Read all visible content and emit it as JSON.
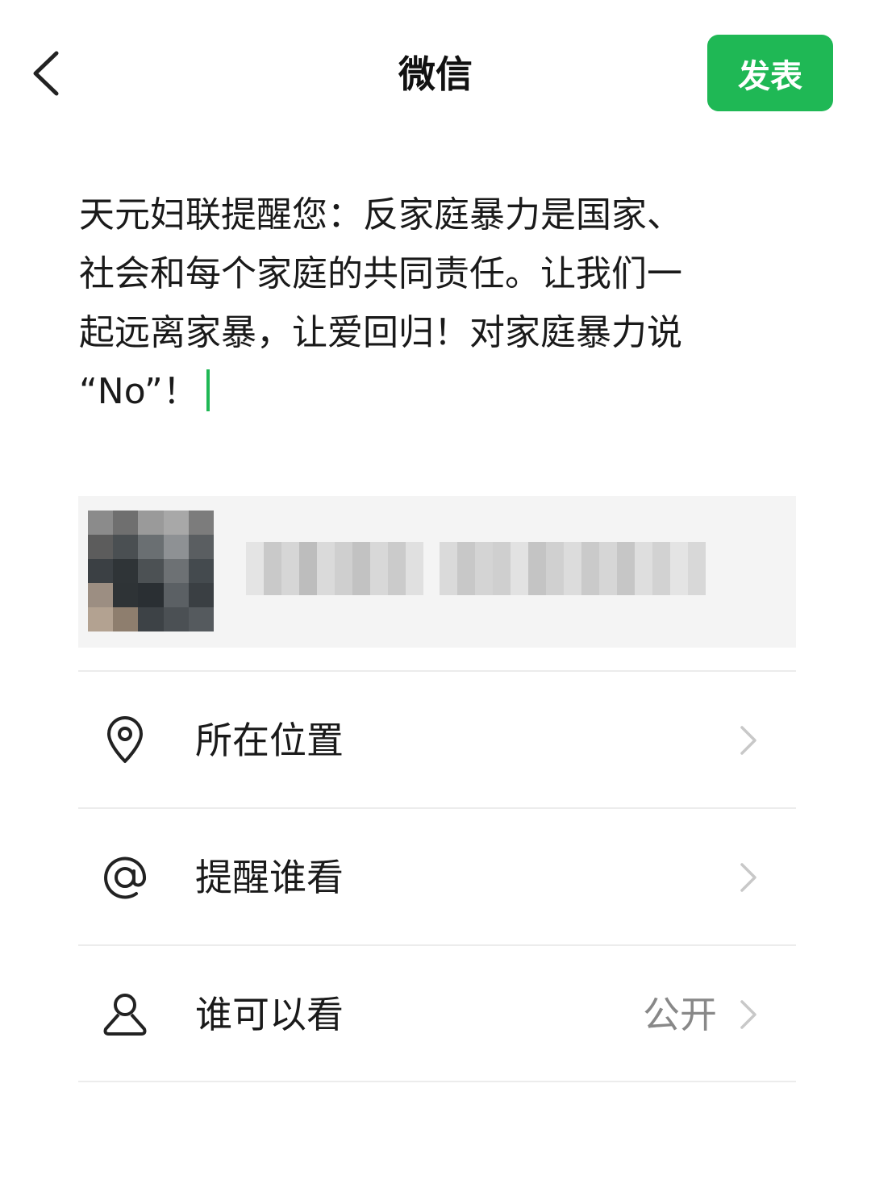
{
  "header": {
    "title": "微信",
    "publish_label": "发表"
  },
  "post": {
    "text": "天元妇联提醒您：反家庭暴力是国家、\n社会和每个家庭的共同责任。让我们一\n起远离家暴，让爱回归！对家庭暴力说\n“No”！"
  },
  "rows": [
    {
      "label": "所在位置",
      "value": ""
    },
    {
      "label": "提醒谁看",
      "value": ""
    },
    {
      "label": "谁可以看",
      "value": "公开"
    }
  ],
  "colors": {
    "accent": "#1fb855",
    "divider": "#ececec",
    "secondary_text": "#888888"
  },
  "icons": {
    "back": "chevron-left-icon",
    "location": "location-pin-icon",
    "mention": "at-icon",
    "visibility": "person-icon",
    "row_arrow": "chevron-right-icon"
  }
}
